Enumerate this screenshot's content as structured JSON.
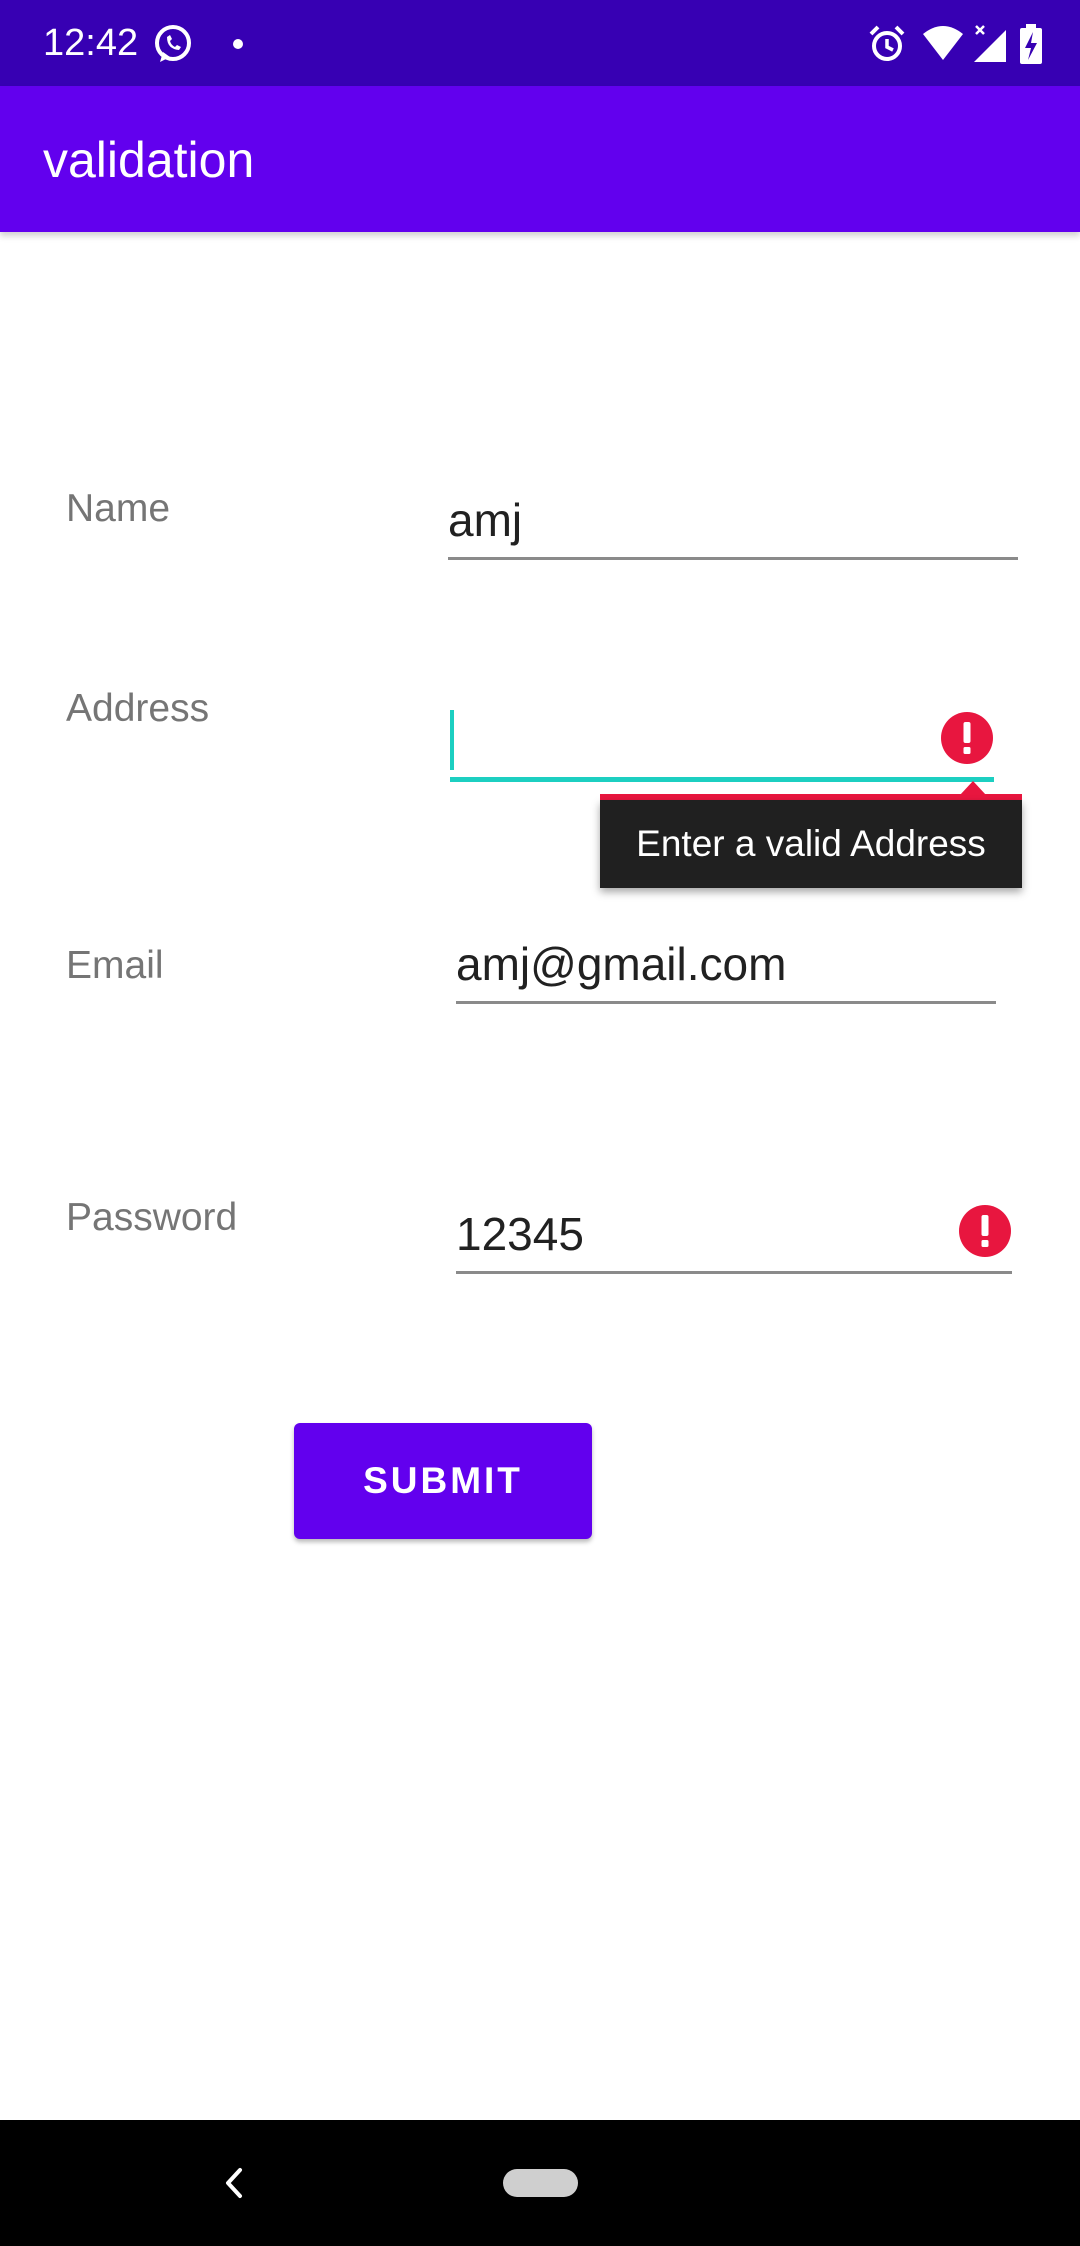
{
  "status_bar": {
    "time": "12:42",
    "left_icons": [
      "whatsapp-icon",
      "notification-dot-icon"
    ],
    "right_icons": [
      "alarm-icon",
      "wifi-icon",
      "signal-icon",
      "battery-charging-icon"
    ]
  },
  "app_bar": {
    "title": "validation"
  },
  "form": {
    "name": {
      "label": "Name",
      "value": "amj"
    },
    "address": {
      "label": "Address",
      "value": "",
      "error": "Enter a valid Address"
    },
    "email": {
      "label": "Email",
      "value": "amj@gmail.com"
    },
    "password": {
      "label": "Password",
      "value": "12345"
    }
  },
  "submit_button": {
    "label": "SUBMIT"
  },
  "colors": {
    "status_bar": "#3700b3",
    "app_bar": "#6200ee",
    "accent": "#1ccfc1",
    "error": "#e8163f"
  },
  "nav_bar": {
    "icons": [
      "back-icon",
      "home-pill-icon"
    ]
  }
}
